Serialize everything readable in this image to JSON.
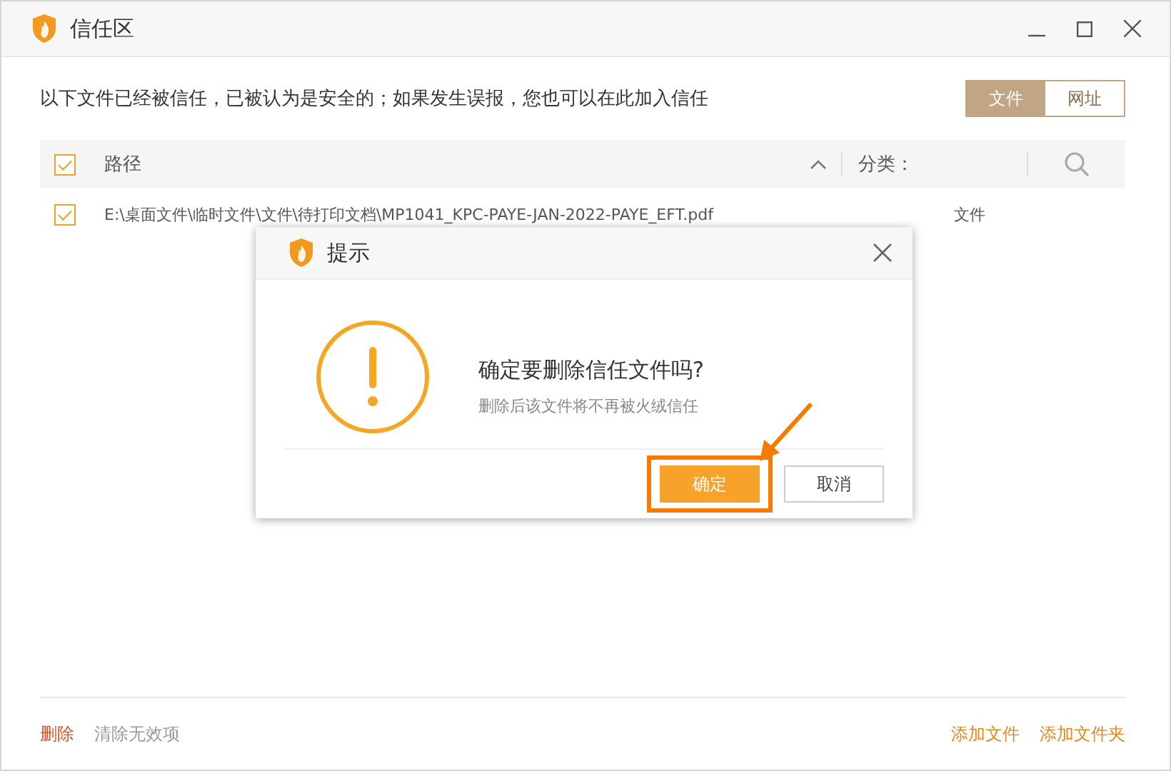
{
  "window": {
    "title": "信任区"
  },
  "notice": "以下文件已经被信任，已被认为是安全的；如果发生误报，您也可以在此加入信任",
  "view_tabs": [
    {
      "label": "文件",
      "selected": true
    },
    {
      "label": "网址",
      "selected": false
    }
  ],
  "table": {
    "all_checked": true,
    "columns": [
      "路径",
      "分类："
    ],
    "rows": [
      {
        "checked": true,
        "path": "E:\\桌面文件\\临时文件\\文件\\待打印文档\\MP1041_KPC-PAYE-JAN-2022-PAYE_EFT.pdf",
        "category": "文件"
      }
    ]
  },
  "footer": {
    "left_actions": [
      {
        "label": "删除",
        "kind": "danger"
      },
      {
        "label": "清除无效项",
        "kind": "plain"
      }
    ],
    "right_actions": [
      {
        "label": "添加文件",
        "kind": "accent"
      },
      {
        "label": "添加文件夹",
        "kind": "accent"
      }
    ]
  },
  "dialog": {
    "title": "提示",
    "message": "确定要删除信任文件吗?",
    "detail": "删除后该文件将不再被火绒信任",
    "buttons": [
      {
        "label": "确定",
        "kind": "primary",
        "highlighted": true
      },
      {
        "label": "取消",
        "kind": "secondary",
        "highlighted": false
      }
    ]
  }
}
